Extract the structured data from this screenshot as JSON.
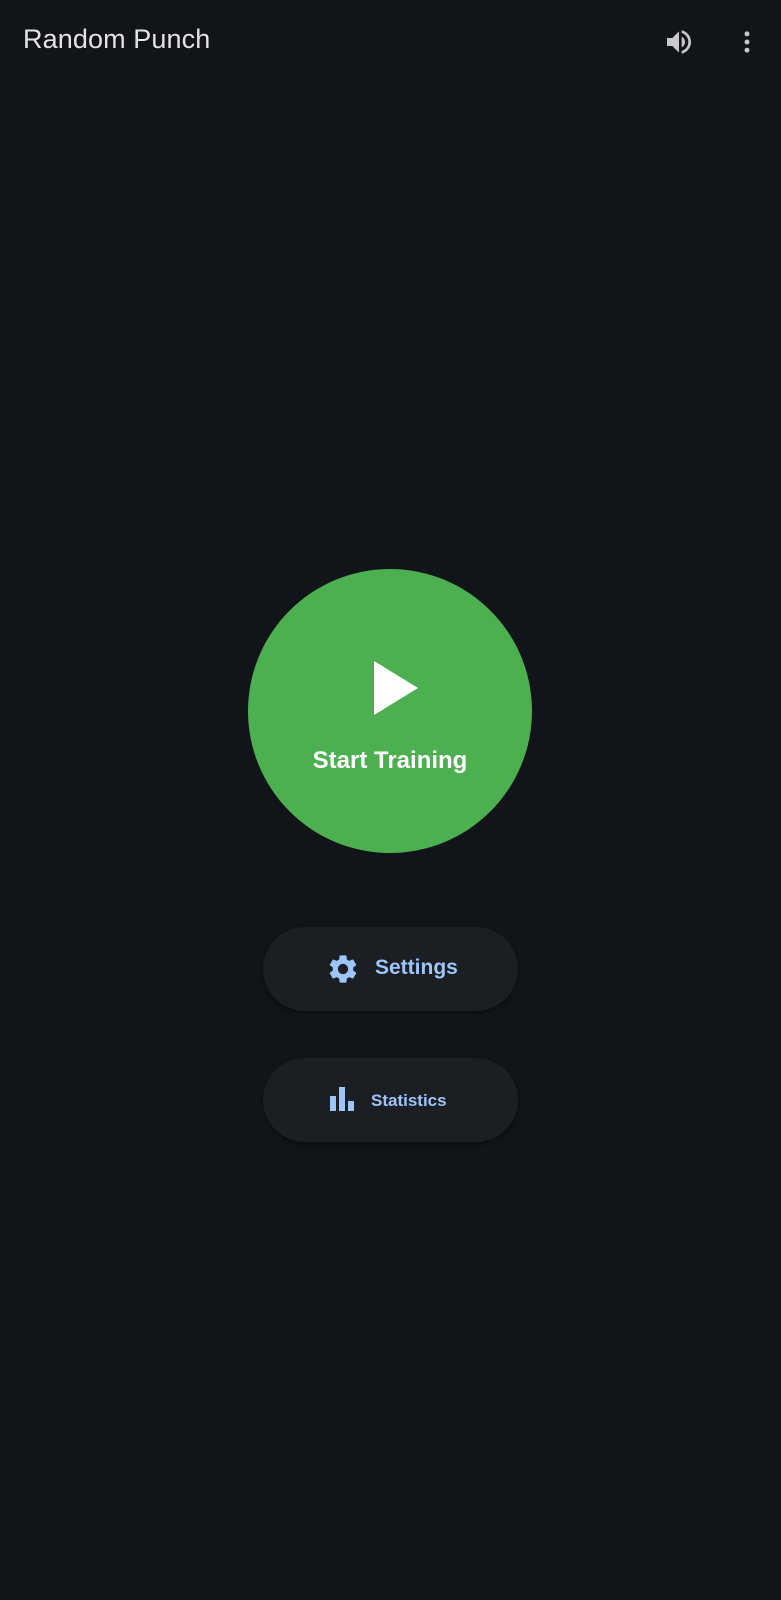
{
  "app_bar": {
    "title": "Random Punch",
    "icons": [
      "volume-up-icon",
      "more-vert-icon"
    ]
  },
  "main": {
    "start_button": {
      "label": "Start Training",
      "icon": "play-icon",
      "color": "#4caf50"
    },
    "settings_button": {
      "label": "Settings",
      "icon": "gear-icon"
    },
    "statistics_button": {
      "label": "Statistics",
      "icon": "bar-chart-icon"
    }
  },
  "colors": {
    "background": "#111418",
    "accent_text": "#9ec5f8",
    "button_surface": "#1b1e23",
    "title_text": "#e3e3e6"
  }
}
